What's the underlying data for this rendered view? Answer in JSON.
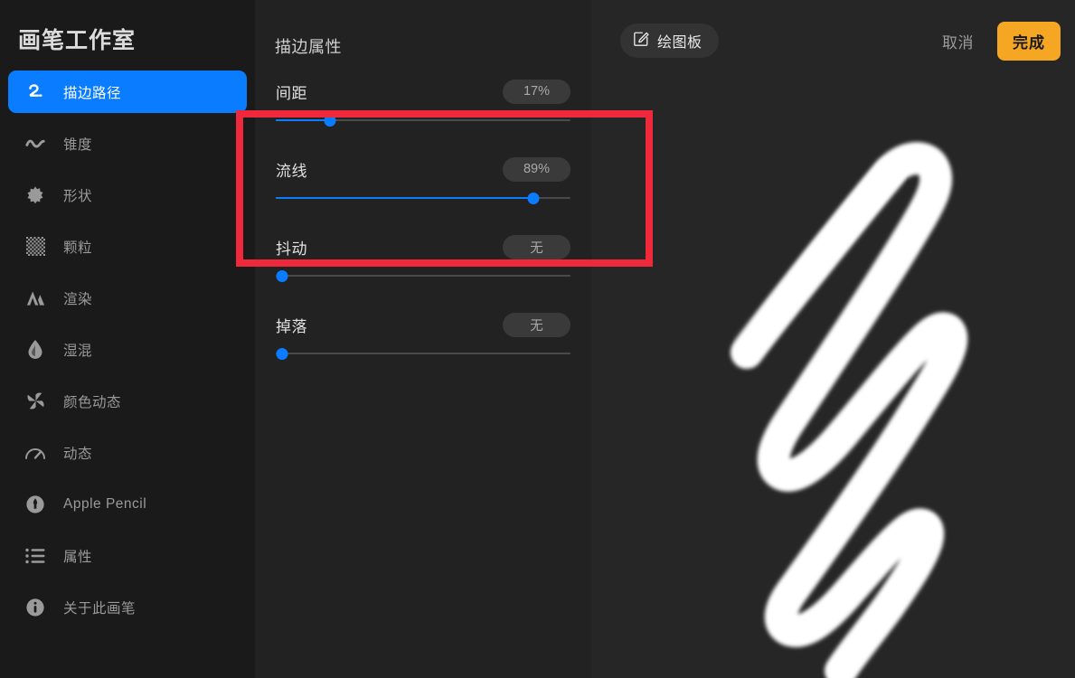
{
  "sidebar": {
    "title": "画笔工作室",
    "items": [
      {
        "label": "描边路径",
        "icon": "stroke-path-icon",
        "active": true
      },
      {
        "label": "锥度",
        "icon": "taper-icon",
        "active": false
      },
      {
        "label": "形状",
        "icon": "shape-icon",
        "active": false
      },
      {
        "label": "颗粒",
        "icon": "grain-icon",
        "active": false
      },
      {
        "label": "渲染",
        "icon": "rendering-icon",
        "active": false
      },
      {
        "label": "湿混",
        "icon": "wet-mix-icon",
        "active": false
      },
      {
        "label": "颜色动态",
        "icon": "color-dynamics-icon",
        "active": false
      },
      {
        "label": "动态",
        "icon": "dynamics-icon",
        "active": false
      },
      {
        "label": "Apple Pencil",
        "icon": "apple-pencil-icon",
        "active": false
      },
      {
        "label": "属性",
        "icon": "attributes-icon",
        "active": false
      },
      {
        "label": "关于此画笔",
        "icon": "info-icon",
        "active": false
      }
    ]
  },
  "panel": {
    "title": "描边属性",
    "sliders": [
      {
        "label": "间距",
        "value": "17%",
        "percent": 17
      },
      {
        "label": "流线",
        "value": "89%",
        "percent": 89
      },
      {
        "label": "抖动",
        "value": "无",
        "percent": 0
      },
      {
        "label": "掉落",
        "value": "无",
        "percent": 0
      }
    ]
  },
  "toolbar": {
    "canvas_button": "绘图板",
    "canvas_button_icon": "edit-square-icon",
    "cancel_button": "取消",
    "done_button": "完成"
  },
  "colors": {
    "accent_blue": "#0a7cff",
    "done_orange": "#f5a623",
    "annotation_red": "#f0283c",
    "sidebar_bg": "#1a1a1a",
    "panel_bg": "#222222",
    "preview_bg": "#262626",
    "stroke_white": "#ffffff"
  },
  "annotation": {
    "type": "red-highlight-rectangle",
    "targets": [
      "流线",
      "抖动"
    ]
  }
}
